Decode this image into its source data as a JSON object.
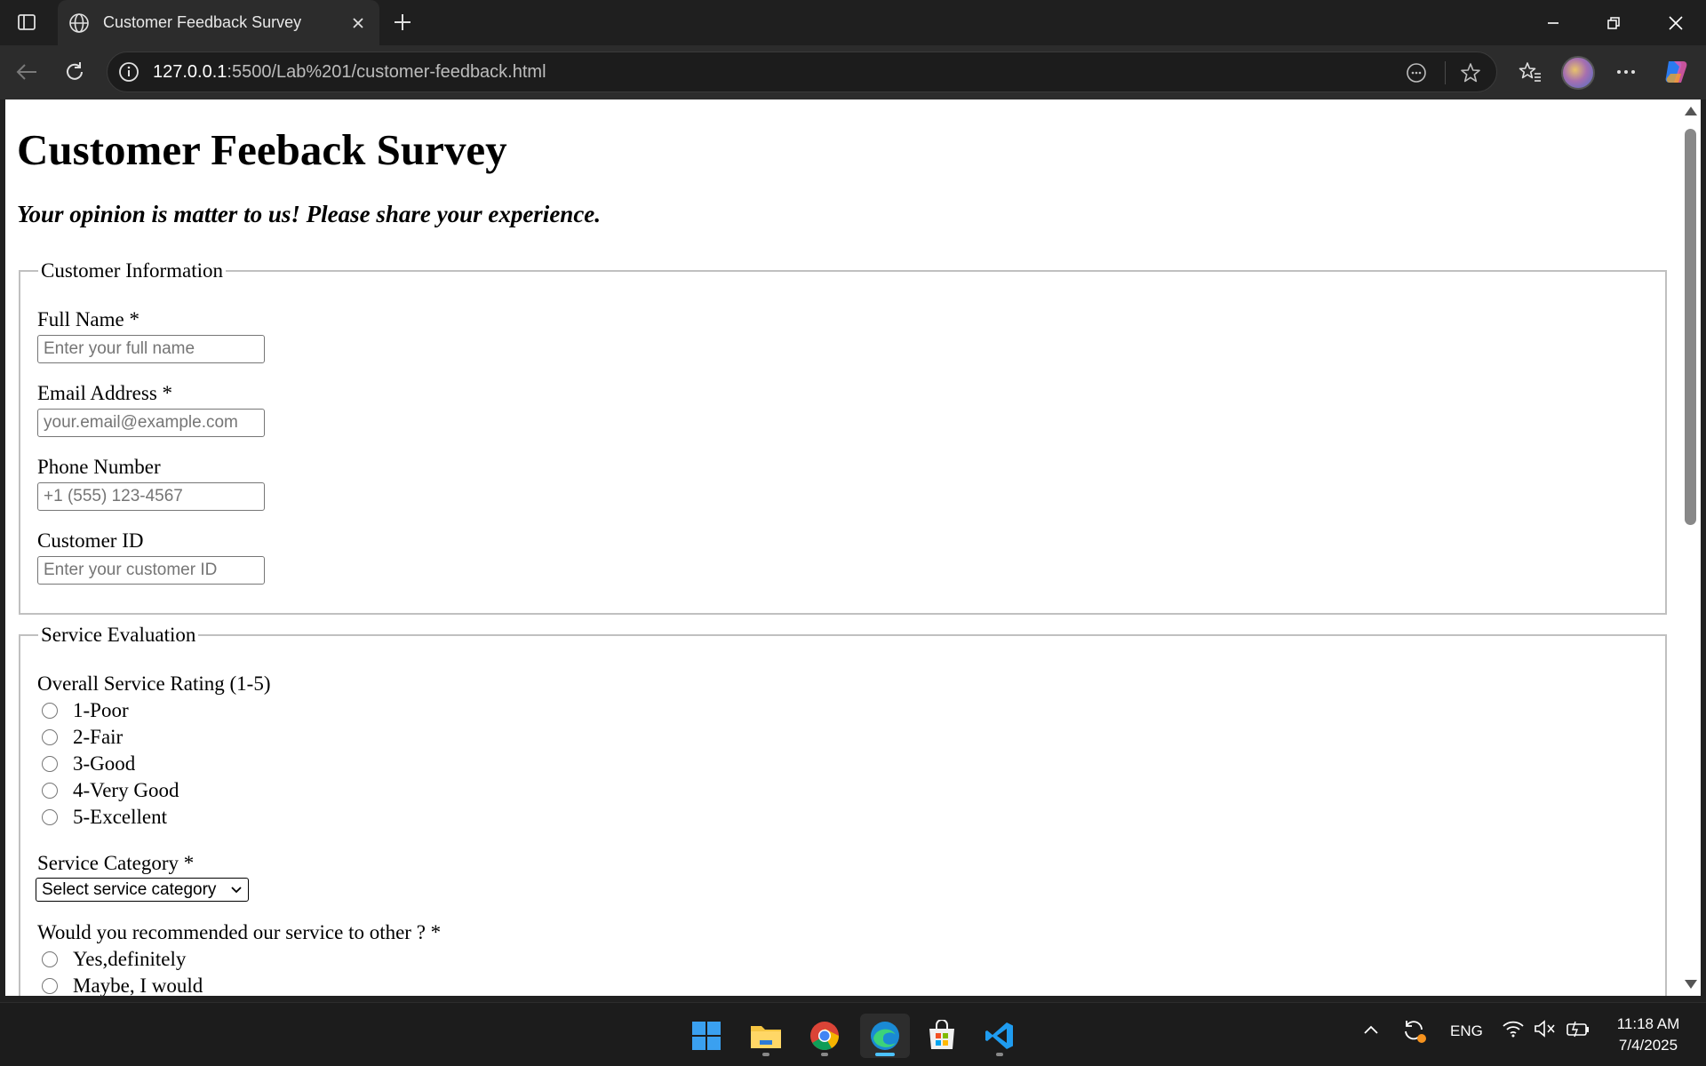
{
  "browser": {
    "tab_title": "Customer Feedback Survey",
    "url_host": "127.0.0.1",
    "url_path": ":5500/Lab%201/customer-feedback.html",
    "icons": [
      "tab-actions-icon",
      "globe-icon",
      "close-icon",
      "plus-icon",
      "minimize-icon",
      "restore-icon",
      "back-icon",
      "reload-icon",
      "info-icon",
      "read-aloud-icon",
      "star-icon",
      "favorites-icon",
      "profile-avatar",
      "more-icon",
      "copilot-icon"
    ]
  },
  "page": {
    "title": "Customer Feeback Survey",
    "subtitle": "Your opinion is matter to us! Please share your experience.",
    "customer_info": {
      "legend": "Customer Information",
      "full_name_label": "Full Name *",
      "full_name_placeholder": "Enter your full name",
      "email_label": "Email Address *",
      "email_placeholder": "your.email@example.com",
      "phone_label": "Phone Number",
      "phone_placeholder": "+1 (555) 123-4567",
      "customer_id_label": "Customer ID",
      "customer_id_placeholder": "Enter your customer ID"
    },
    "service_eval": {
      "legend": "Service Evaluation",
      "rating_label": "Overall Service Rating (1-5)",
      "ratings": [
        "1-Poor",
        "2-Fair",
        "3-Good",
        "4-Very Good",
        "5-Excellent"
      ],
      "category_label": "Service Category *",
      "category_selected": "Select service category",
      "recommend_label": "Would you recommended our service to other ? *",
      "recommend_options": [
        "Yes,definitely",
        "Maybe, I would"
      ]
    }
  },
  "taskbar": {
    "apps": [
      "windows-start-icon",
      "file-explorer-icon",
      "chrome-icon",
      "edge-icon",
      "microsoft-store-icon",
      "vscode-icon"
    ],
    "language": "ENG",
    "time": "11:18 AM",
    "date": "7/4/2025"
  },
  "colors": {
    "accent": "#4cc2ff",
    "browser_bg": "#1f1f1f",
    "toolbar_bg": "#2c2c2c"
  }
}
